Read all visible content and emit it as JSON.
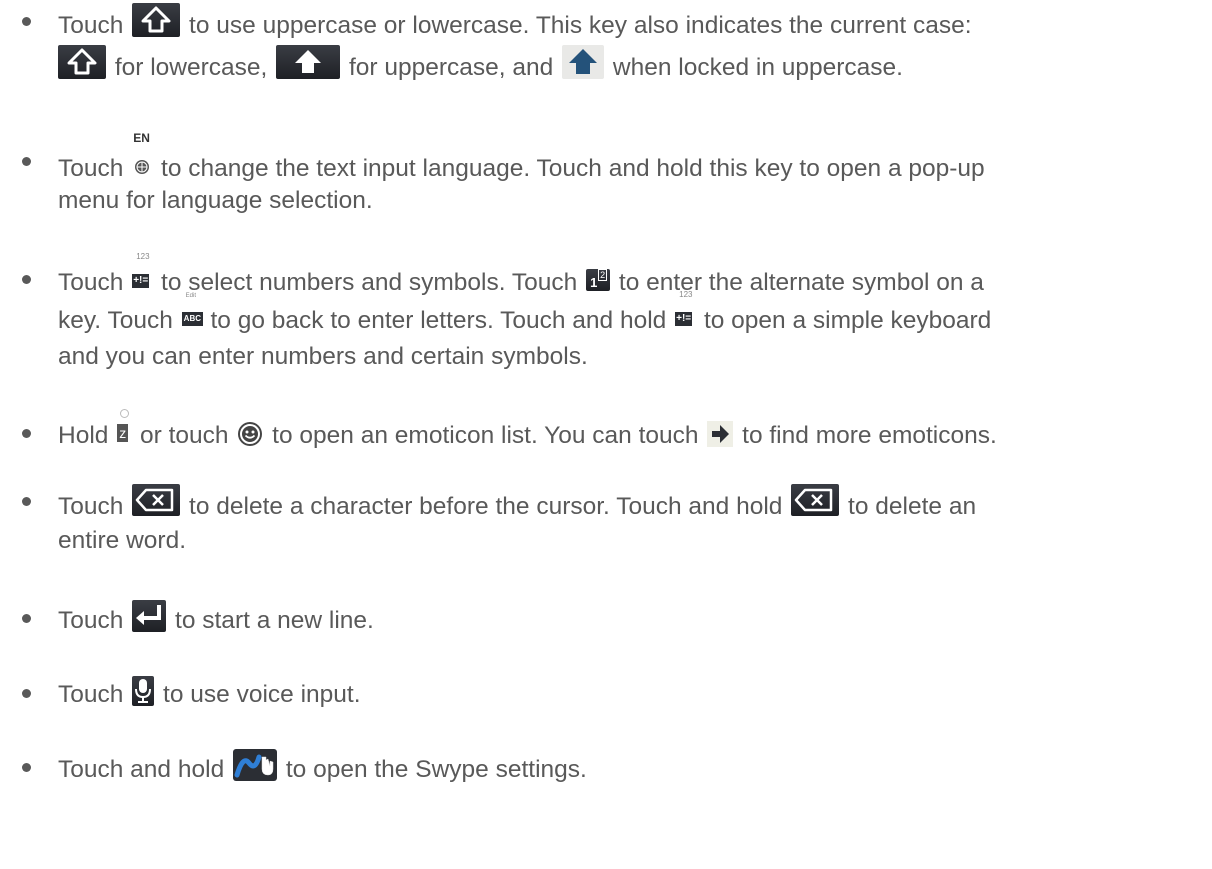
{
  "items": [
    {
      "lines": [
        {
          "s1": "Touch",
          "s2": "to use uppercase or lowercase. This key also indicates the current case:"
        },
        {
          "s1": "for lowercase,",
          "s2": "for uppercase, and",
          "s3": "when locked in uppercase."
        }
      ],
      "icons": [
        "shift-lowercase-icon",
        "shift-lowercase-icon",
        "shift-uppercase-icon",
        "shift-locked-icon"
      ]
    },
    {
      "lines": [
        {
          "s1": "Touch",
          "s2": "to change the text input language. Touch and hold this key to open a pop-up"
        },
        {
          "s1": "menu for language selection."
        }
      ],
      "icon_label": "EN",
      "icons": [
        "language-globe-icon"
      ]
    },
    {
      "lines": [
        {
          "s1": "Touch",
          "s2": "to select numbers and symbols. Touch",
          "s3": "to enter the alternate symbol on a"
        },
        {
          "s1": "key. Touch",
          "s2": "to go back to enter letters. Touch and hold",
          "s3": "to open a simple keyboard"
        },
        {
          "s1": "and you can enter numbers and certain symbols."
        }
      ],
      "sym_key": {
        "top": "123",
        "bottom": "+!="
      },
      "alt_key": {
        "top": "2",
        "bottom": "1"
      },
      "abc_key": {
        "top": "Edit",
        "bottom": "ABC"
      },
      "icons": [
        "symbols-key-icon",
        "alternate-symbol-icon",
        "abc-key-icon",
        "symbols-key-icon"
      ]
    },
    {
      "lines": [
        {
          "s1": "Hold",
          "s2": "or touch",
          "s3": "to open an emoticon list. You can touch",
          "s4": "to find more emoticons."
        }
      ],
      "z_key": "z",
      "icons": [
        "z-key-icon",
        "smiley-icon",
        "arrow-right-icon"
      ]
    },
    {
      "lines": [
        {
          "s1": "Touch",
          "s2": "to delete a character before the cursor. Touch and hold",
          "s3": "to delete an"
        },
        {
          "s1": "entire word."
        }
      ],
      "icons": [
        "backspace-icon",
        "backspace-icon"
      ]
    },
    {
      "lines": [
        {
          "s1": "Touch",
          "s2": "to start a new line."
        }
      ],
      "icons": [
        "enter-icon"
      ]
    },
    {
      "lines": [
        {
          "s1": "Touch",
          "s2": "to use voice input."
        }
      ],
      "icons": [
        "microphone-icon"
      ]
    },
    {
      "lines": [
        {
          "s1": "Touch and hold",
          "s2": "to open the Swype settings."
        }
      ],
      "icons": [
        "swype-icon"
      ]
    }
  ],
  "colors": {
    "text": "#595959",
    "key": "#2b2e34",
    "accent": "#2f7fd6"
  }
}
